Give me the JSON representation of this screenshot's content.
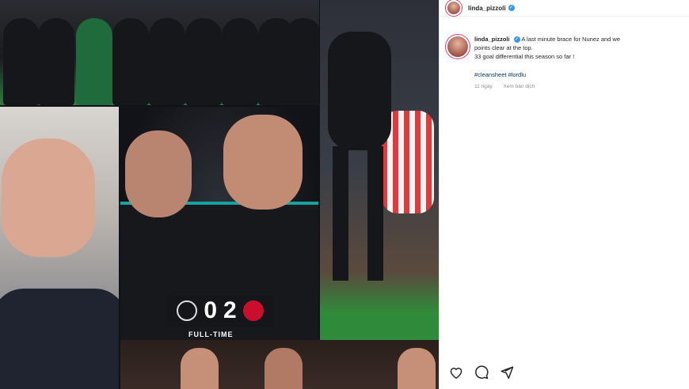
{
  "post": {
    "username": "linda_pizzoli",
    "verified_mark": "✓",
    "caption_line1": "A last minute brace for Nunez and we",
    "caption_line2": "points clear at the top.",
    "caption_line3": "33 goal differential this season so far !",
    "hashtags": "#cleansheet #lordlu",
    "time_ago": "11 ngày",
    "see_translation": "Xem bản dịch",
    "score_home": "0",
    "score_away": "2",
    "full_time": "FULL-TIME"
  },
  "icons": {
    "like": "heart-icon",
    "comment": "comment-icon",
    "share": "share-icon",
    "verified": "verified-badge-icon"
  },
  "colors": {
    "accent_blue": "#3897f0",
    "link": "#00376b",
    "liverpool_red": "#c8102e",
    "pitch_green": "#2f8a3a"
  }
}
